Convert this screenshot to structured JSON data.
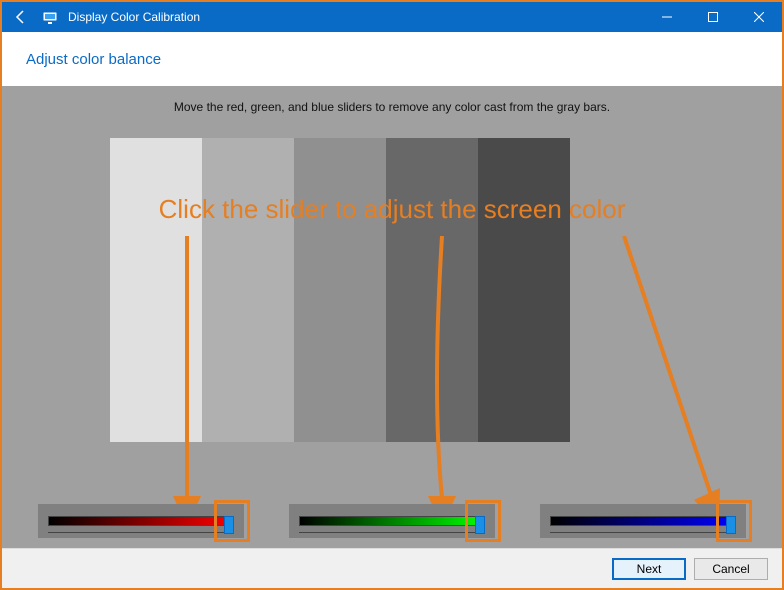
{
  "titlebar": {
    "app_name": "Display Color Calibration"
  },
  "page": {
    "heading": "Adjust color balance",
    "instruction": "Move the red, green, and blue sliders to remove any color cast from the gray bars."
  },
  "gray_bars": {
    "shades": [
      "#e0e0e0",
      "#b0b0b0",
      "#909090",
      "#686868",
      "#4a4a4a"
    ]
  },
  "sliders": {
    "red": {
      "gradient_from": "#000000",
      "gradient_to": "#ff0000",
      "thumb_pos_pct": 100
    },
    "green": {
      "gradient_from": "#000000",
      "gradient_to": "#00ff00",
      "thumb_pos_pct": 100
    },
    "blue": {
      "gradient_from": "#000000",
      "gradient_to": "#0000ff",
      "thumb_pos_pct": 100
    }
  },
  "annotation": {
    "text": "Click the slider to adjust the screen color",
    "color": "#e67e22"
  },
  "footer": {
    "next_label": "Next",
    "cancel_label": "Cancel"
  }
}
